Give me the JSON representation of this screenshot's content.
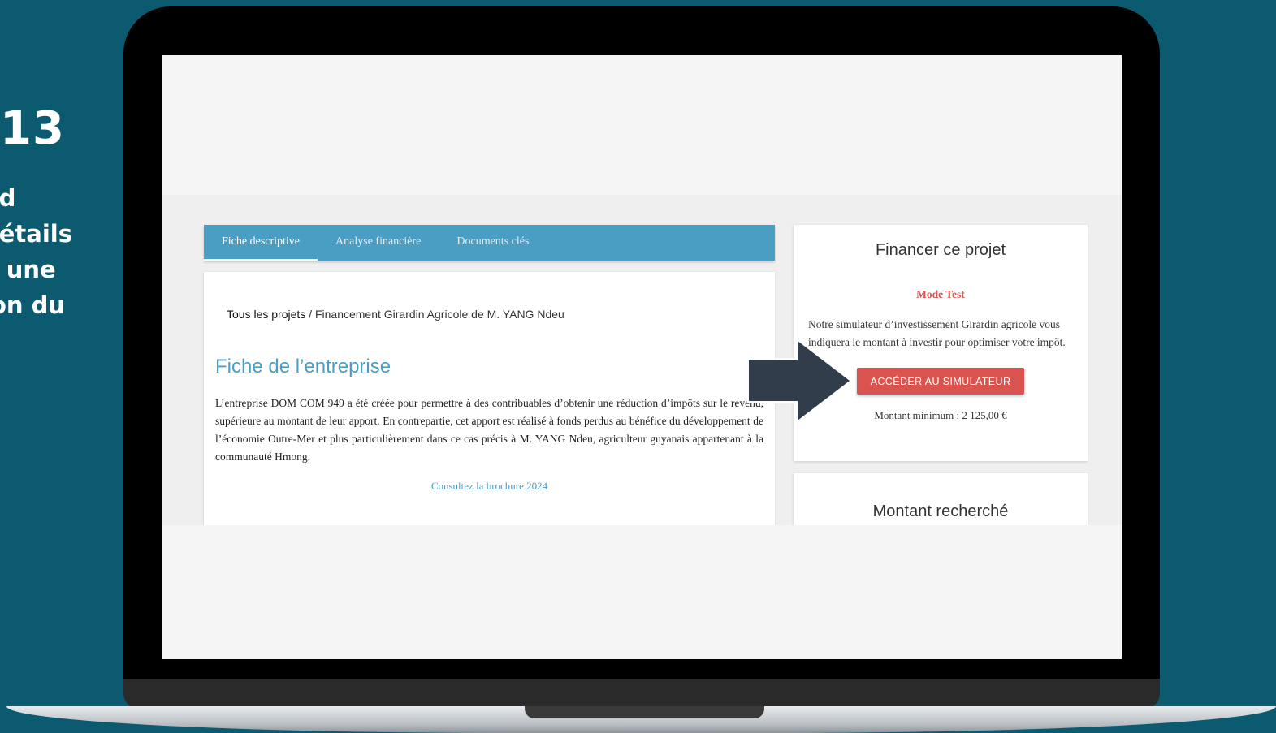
{
  "slide": {
    "number": "13",
    "caption": "nd\ndétails\ne une\nion du\nt"
  },
  "tabs": [
    {
      "label": "Fiche descriptive",
      "active": true
    },
    {
      "label": "Analyse financière",
      "active": false
    },
    {
      "label": "Documents clés",
      "active": false
    }
  ],
  "breadcrumb": {
    "root": "Tous les projets",
    "separator": " / ",
    "current": "Financement Girardin Agricole de M. YANG Ndeu"
  },
  "company": {
    "title": "Fiche de l’entreprise",
    "description": "L’entreprise DOM COM 949 a été créée pour permettre à des contribuables d’obtenir une réduction d’impôts sur le revenu, supérieure au montant de leur apport. En contrepartie, cet apport est réalisé à fonds perdus au bénéfice du développement de l’économie Outre-Mer et plus particulièrement dans ce cas précis à M. YANG Ndeu, agriculteur guyanais appartenant à la communauté Hmong.",
    "brochure_link": "Consultez la brochure 2024"
  },
  "fund_card": {
    "title": "Financer ce projet",
    "mode": "Mode Test",
    "simulator_text": "Notre simulateur d’investissement Girardin agricole vous indiquera le montant à investir pour optimiser votre impôt.",
    "button_label": "ACCÉDER AU SIMULATEUR",
    "min_amount": "Montant minimum : 2 125,00 €"
  },
  "amount_card": {
    "title": "Montant recherché"
  },
  "colors": {
    "background": "#0b5a70",
    "accent": "#4a9ec4",
    "button": "#d9534f",
    "arrow": "#323d4b"
  }
}
